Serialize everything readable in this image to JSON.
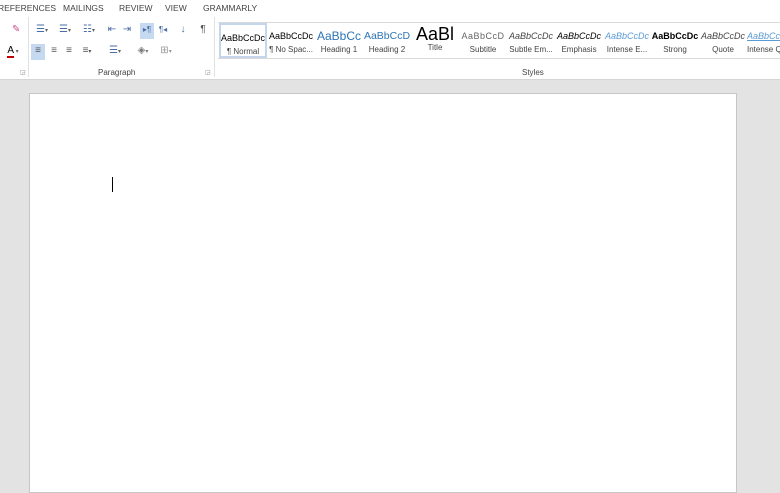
{
  "tabs": [
    "REFERENCES",
    "MAILINGS",
    "REVIEW",
    "VIEW",
    "GRAMMARLY"
  ],
  "groups": {
    "paragraph": "Paragraph",
    "styles": "Styles"
  },
  "styles": [
    {
      "preview": "AaBbCcDc",
      "name": "¶ Normal"
    },
    {
      "preview": "AaBbCcDc",
      "name": "¶ No Spac..."
    },
    {
      "preview": "AaBbCc",
      "name": "Heading 1"
    },
    {
      "preview": "AaBbCcD",
      "name": "Heading 2"
    },
    {
      "preview": "AaBl",
      "name": "Title"
    },
    {
      "preview": "AaBbCcD",
      "name": "Subtitle"
    },
    {
      "preview": "AaBbCcDc",
      "name": "Subtle Em..."
    },
    {
      "preview": "AaBbCcDc",
      "name": "Emphasis"
    },
    {
      "preview": "AaBbCcDc",
      "name": "Intense E..."
    },
    {
      "preview": "AaBbCcDc",
      "name": "Strong"
    },
    {
      "preview": "AaBbCcDc",
      "name": "Quote"
    },
    {
      "preview": "AaBbCcDc",
      "name": "Intense Q..."
    }
  ],
  "icons": {
    "pilcrow": "¶",
    "font_color": "A"
  },
  "colors": {
    "accent": "#2e75b6",
    "font_color_bar": "#c00000"
  }
}
